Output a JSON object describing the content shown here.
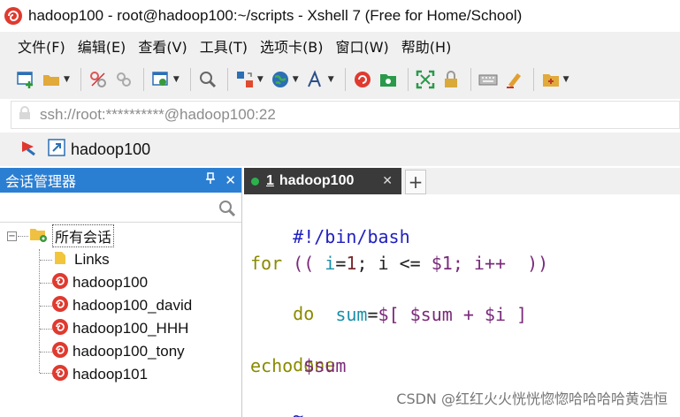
{
  "window": {
    "title": "hadoop100 - root@hadoop100:~/scripts - Xshell 7 (Free for Home/School)"
  },
  "menu": {
    "items": [
      "文件(F)",
      "编辑(E)",
      "查看(V)",
      "工具(T)",
      "选项卡(B)",
      "窗口(W)",
      "帮助(H)"
    ]
  },
  "address": {
    "text": "ssh://root:**********@hadoop100:22"
  },
  "session_bar": {
    "label": "hadoop100"
  },
  "session_manager": {
    "title": "会话管理器",
    "pin": "ᵽ",
    "close": "✕",
    "search_placeholder": "",
    "root_label": "所有会话",
    "items": [
      "Links",
      "hadoop100",
      "hadoop100_david",
      "hadoop100_HHH",
      "hadoop100_tony",
      "hadoop101"
    ]
  },
  "tab": {
    "number": "1",
    "label": "hadoop100",
    "close": "✕",
    "add": "+"
  },
  "terminal": {
    "shebang": "#!/bin/bash",
    "for_kw": "for",
    "for_open": " (( ",
    "for_var": "i",
    "for_eq": "=",
    "for_one": "1",
    "for_mid": "; i <= ",
    "for_arg": "$1",
    "for_end": "; i++  ))",
    "do_kw": "do",
    "sum_indent": "        ",
    "sum_var": "sum",
    "sum_assign": "=",
    "sum_expr": "$[ $sum + $i ]",
    "done_kw": "done",
    "echo_kw": "echo",
    "echo_arg": " $sum",
    "tilde": "~"
  },
  "watermark": "CSDN @红红火火恍恍惚惚哈哈哈哈黄浩恒",
  "colors": {
    "panel_header": "#2b7fd3",
    "tab_active": "#3a3a3a",
    "status_dot": "#2bb24c",
    "keyword": "#8a8a00",
    "variable": "#1a8fa8"
  }
}
